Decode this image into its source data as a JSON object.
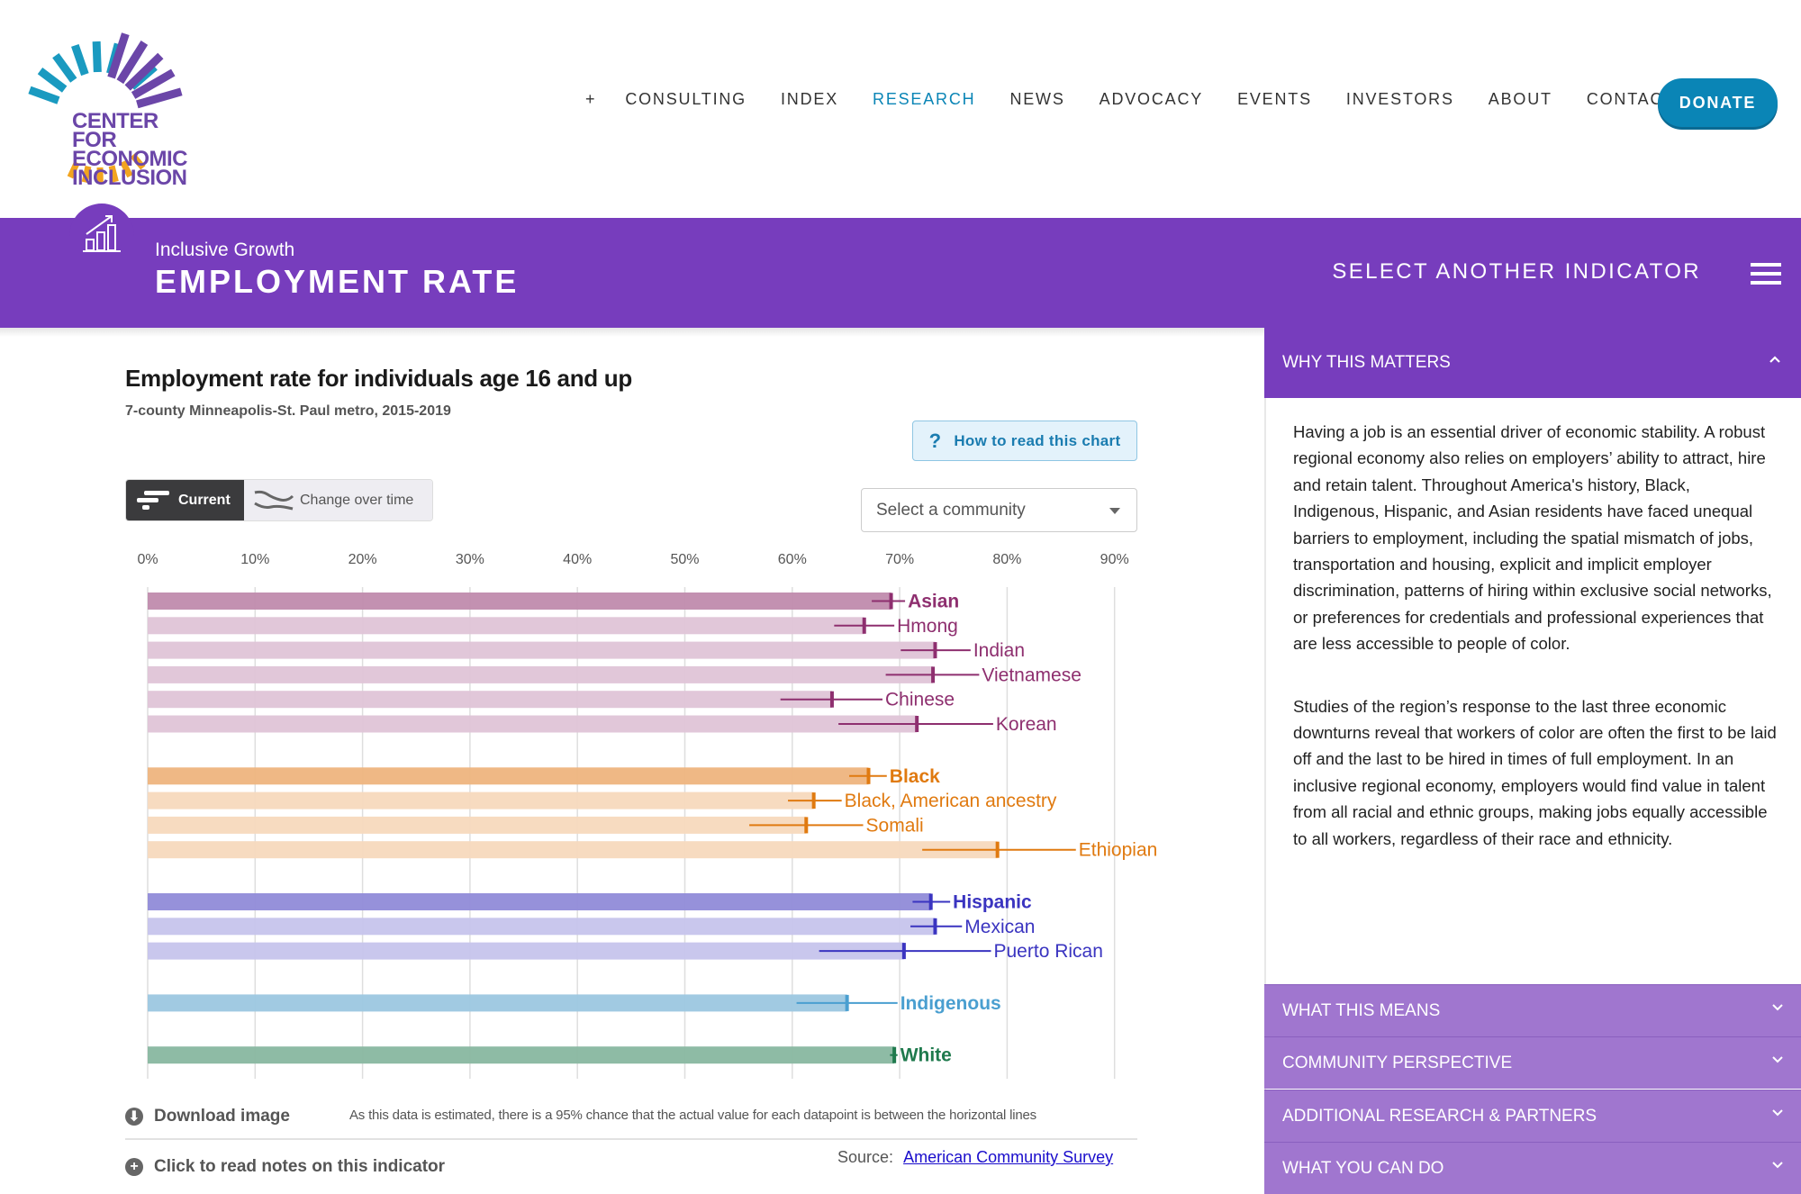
{
  "header": {
    "logo_text": [
      "CENTER FOR",
      "ECONOMIC",
      "INCLUSION"
    ],
    "nav": [
      {
        "label": "+",
        "active": false
      },
      {
        "label": "CONSULTING",
        "active": false
      },
      {
        "label": "INDEX",
        "active": false
      },
      {
        "label": "RESEARCH",
        "active": true
      },
      {
        "label": "NEWS",
        "active": false
      },
      {
        "label": "ADVOCACY",
        "active": false
      },
      {
        "label": "EVENTS",
        "active": false
      },
      {
        "label": "INVESTORS",
        "active": false
      },
      {
        "label": "ABOUT",
        "active": false
      },
      {
        "label": "CONTACT",
        "active": false
      }
    ],
    "donate_label": "DONATE",
    "accent_color": "#0a85b6"
  },
  "banner": {
    "icon": "bar-chart-growth-icon",
    "subtitle": "Inclusive Growth",
    "title": "EMPLOYMENT RATE",
    "select_indicator_label": "SELECT ANOTHER INDICATOR",
    "color": "#773dbd"
  },
  "main": {
    "chart_title": "Employment rate for individuals age 16 and up",
    "chart_subtitle": "7-county Minneapolis-St. Paul metro, 2015-2019",
    "how_to_read_label": "How to read this chart",
    "toggle": {
      "current_label": "Current",
      "change_label": "Change over time",
      "selected": "Current"
    },
    "community_select": {
      "placeholder": "Select a community",
      "value": ""
    },
    "download_label": "Download image",
    "estimate_note": "As this data is estimated, there is a 95% chance that the actual value for each datapoint is between the horizontal lines",
    "notes_label": "Click to read notes on this indicator",
    "source_prefix": "Source:",
    "source_link": "American Community Survey"
  },
  "chart_data": {
    "type": "bar",
    "orientation": "horizontal",
    "title": "Employment rate for individuals age 16 and up",
    "subtitle": "7-county Minneapolis-St. Paul metro, 2015-2019",
    "xlabel": "",
    "ylabel": "",
    "xlim": [
      0,
      90
    ],
    "x_ticks": [
      "0%",
      "10%",
      "20%",
      "30%",
      "40%",
      "50%",
      "60%",
      "70%",
      "80%",
      "90%"
    ],
    "grid": true,
    "error_bars": "95% confidence interval",
    "groups": [
      {
        "name": "Asian",
        "color": "#8e2f6f",
        "bar_color": "#c08bad",
        "sub_bar_color": "#dfc4d7",
        "rows": [
          {
            "label": "Asian",
            "value": 69.2,
            "ci": [
              67.4,
              70.5
            ],
            "primary": true
          },
          {
            "label": "Hmong",
            "value": 66.7,
            "ci": [
              63.9,
              69.5
            ],
            "primary": false
          },
          {
            "label": "Indian",
            "value": 73.3,
            "ci": [
              70.1,
              76.6
            ],
            "primary": false
          },
          {
            "label": "Vietnamese",
            "value": 73.1,
            "ci": [
              68.7,
              77.4
            ],
            "primary": false
          },
          {
            "label": "Chinese",
            "value": 63.7,
            "ci": [
              58.9,
              68.4
            ],
            "primary": false
          },
          {
            "label": "Korean",
            "value": 71.6,
            "ci": [
              64.3,
              78.7
            ],
            "primary": false
          }
        ]
      },
      {
        "name": "Black",
        "color": "#e07a10",
        "bar_color": "#eeb47e",
        "sub_bar_color": "#f7d9bd",
        "rows": [
          {
            "label": "Black",
            "value": 67.1,
            "ci": [
              65.3,
              68.8
            ],
            "primary": true
          },
          {
            "label": "Black, American ancestry",
            "value": 62.0,
            "ci": [
              59.6,
              64.6
            ],
            "primary": false
          },
          {
            "label": "Somali",
            "value": 61.3,
            "ci": [
              56.0,
              66.6
            ],
            "primary": false
          },
          {
            "label": "Ethiopian",
            "value": 79.1,
            "ci": [
              72.1,
              86.4
            ],
            "primary": false
          }
        ]
      },
      {
        "name": "Hispanic",
        "color": "#3a34c0",
        "bar_color": "#908bd8",
        "sub_bar_color": "#c6c4ec",
        "rows": [
          {
            "label": "Hispanic",
            "value": 72.9,
            "ci": [
              71.2,
              74.7
            ],
            "primary": true
          },
          {
            "label": "Mexican",
            "value": 73.3,
            "ci": [
              71.0,
              75.8
            ],
            "primary": false
          },
          {
            "label": "Puerto Rican",
            "value": 70.4,
            "ci": [
              62.5,
              78.5
            ],
            "primary": false
          }
        ]
      },
      {
        "name": "Indigenous",
        "color": "#4a9fd0",
        "bar_color": "#9cc7e0",
        "sub_bar_color": "#9cc7e0",
        "rows": [
          {
            "label": "Indigenous",
            "value": 65.1,
            "ci": [
              60.4,
              69.8
            ],
            "primary": true
          }
        ]
      },
      {
        "name": "White",
        "color": "#1f7a4d",
        "bar_color": "#88b7a0",
        "sub_bar_color": "#88b7a0",
        "rows": [
          {
            "label": "White",
            "value": 69.5,
            "ci": [
              69.1,
              69.8
            ],
            "primary": true
          }
        ]
      }
    ]
  },
  "sidebar": {
    "open_section": {
      "title": "WHY THIS MATTERS",
      "paragraphs": [
        "Having a job is an essential driver of economic stability. A robust regional economy also relies on employers’ ability to attract, hire and retain talent. Throughout America's history, Black, Indigenous, Hispanic, and Asian residents have faced unequal barriers to employment, including the spatial mismatch of jobs, transportation and housing, explicit and implicit employer discrimination, patterns of hiring within exclusive social networks, or preferences for credentials and professional experiences that are less accessible to people of color.",
        "Studies of the region’s response to the last three economic downturns reveal that workers of color are often the first to be laid off and the last to be hired in times of full employment. In an inclusive regional economy, employers would find value in talent from all racial and ethnic groups, making jobs equally accessible to all workers, regardless of their race and ethnicity."
      ]
    },
    "collapsed_sections": [
      "WHAT THIS MEANS",
      "COMMUNITY PERSPECTIVE",
      "ADDITIONAL RESEARCH & PARTNERS",
      "WHAT YOU CAN DO"
    ]
  }
}
